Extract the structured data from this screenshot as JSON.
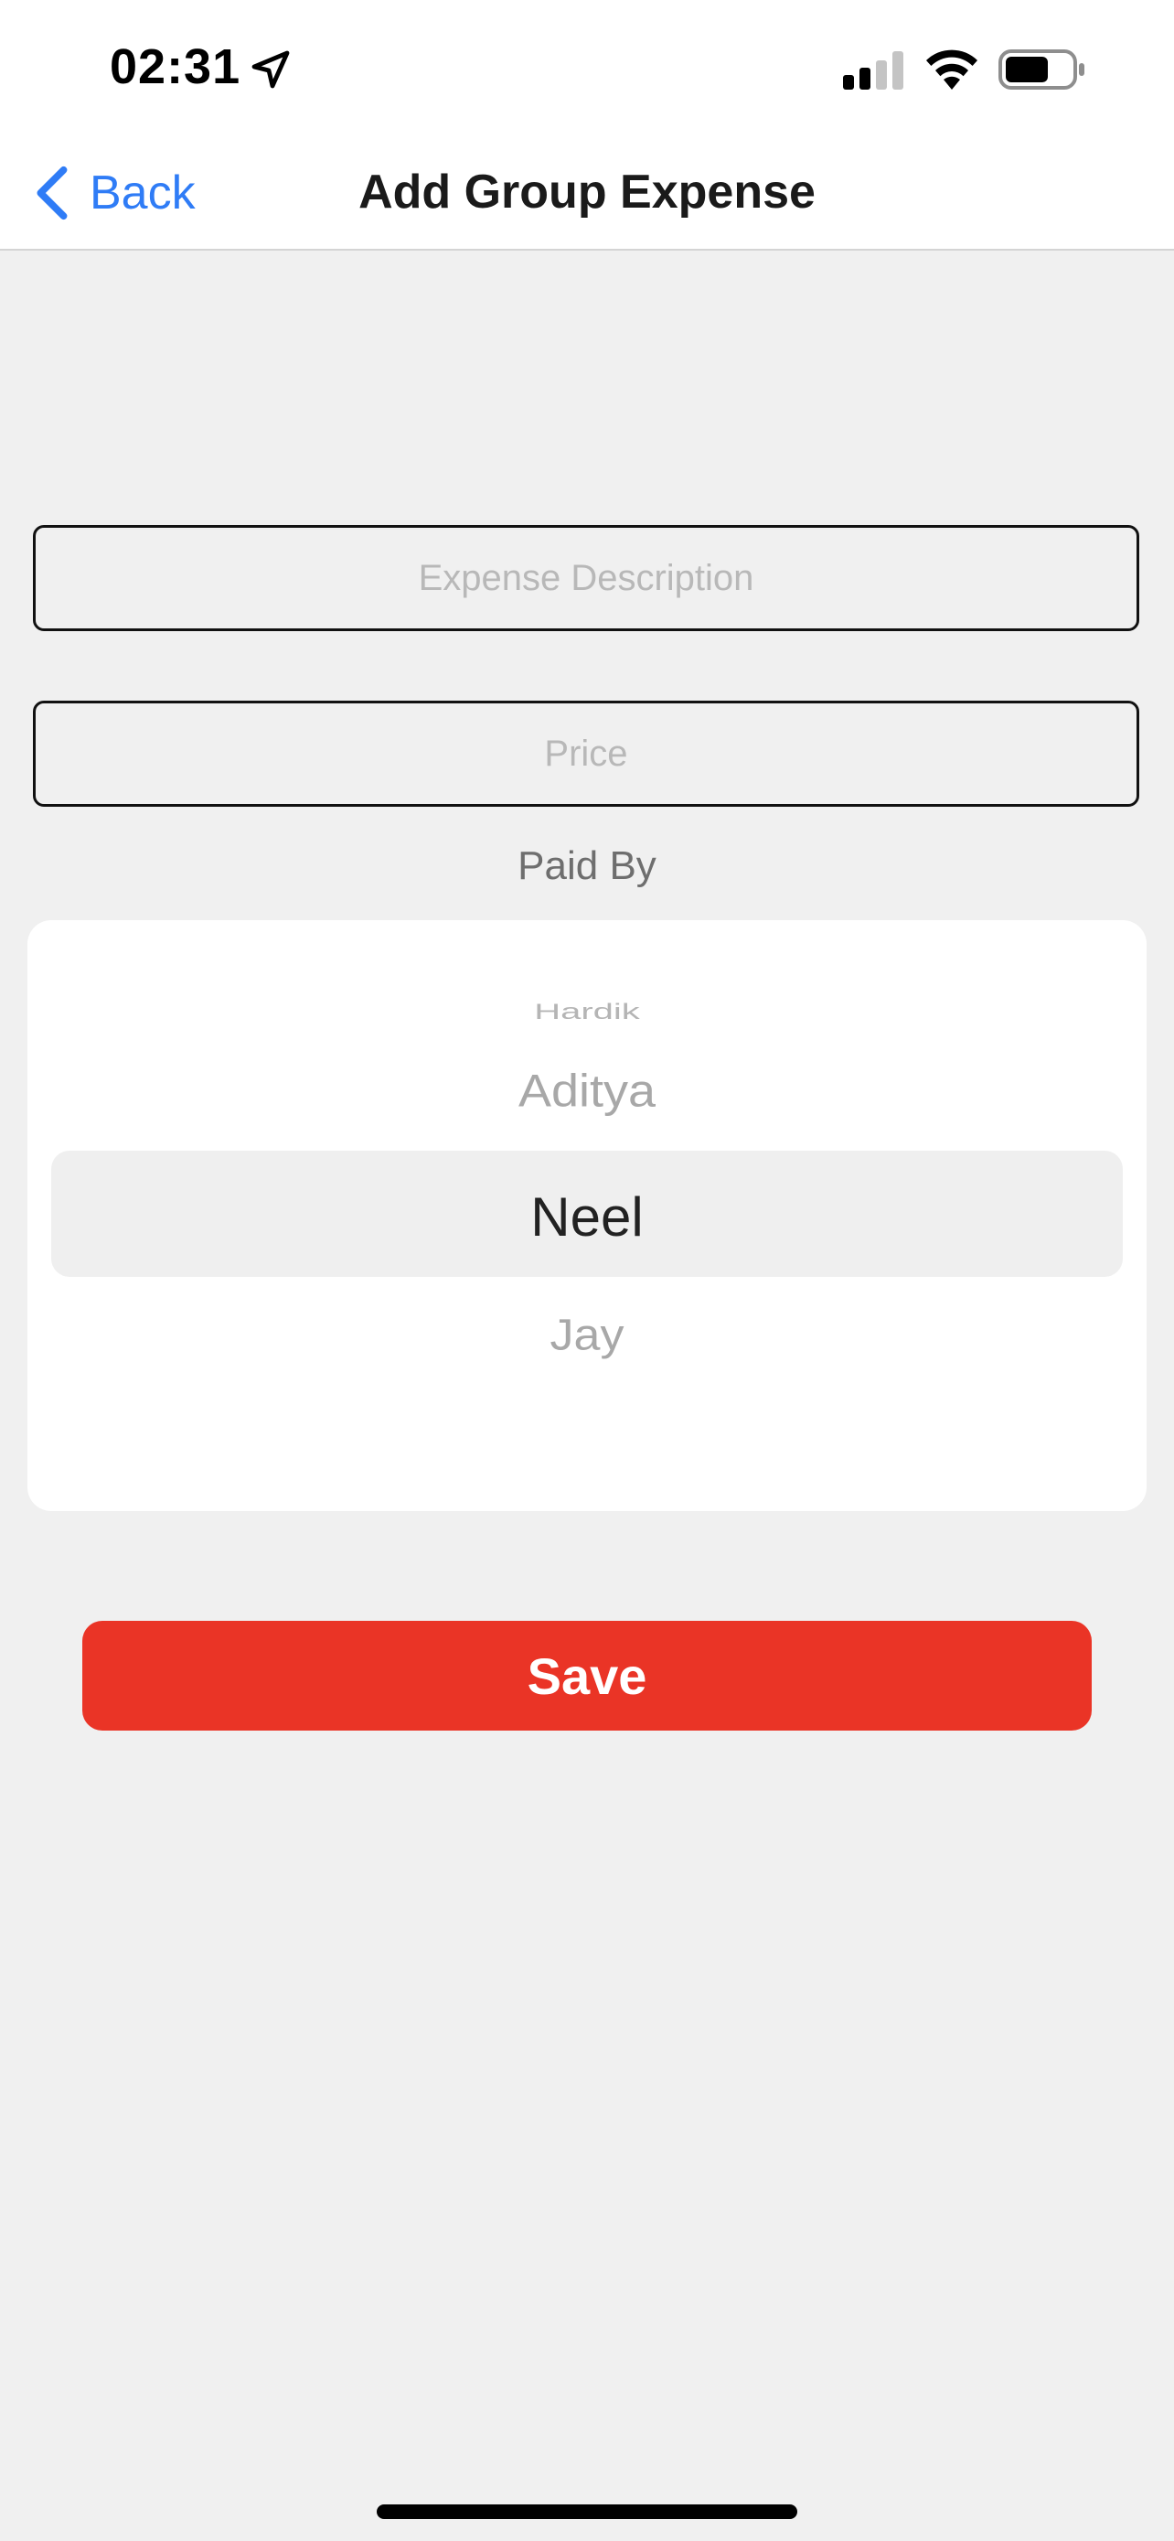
{
  "status_bar": {
    "time": "02:31"
  },
  "nav": {
    "back_label": "Back",
    "title": "Add Group Expense"
  },
  "form": {
    "description": {
      "placeholder": "Expense Description",
      "value": ""
    },
    "price": {
      "placeholder": "Price",
      "value": ""
    },
    "paid_by_label": "Paid By"
  },
  "picker": {
    "items": [
      "Hardik",
      "Aditya",
      "Neel",
      "Jay"
    ],
    "selected": "Neel"
  },
  "save_label": "Save",
  "colors": {
    "accent": "#2f7cf6",
    "save": "#ea3426",
    "background": "#f0f0f0"
  }
}
